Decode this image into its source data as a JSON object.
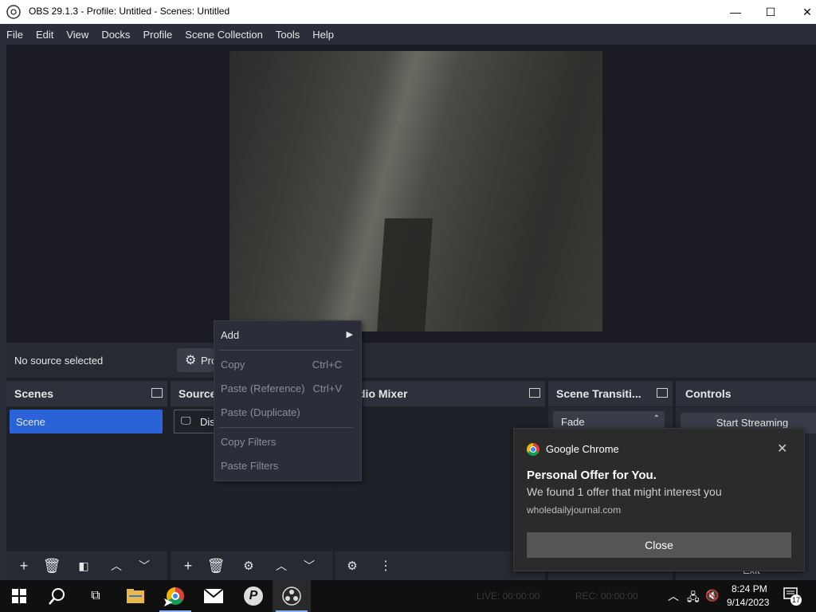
{
  "window": {
    "title": "OBS 29.1.3 - Profile: Untitled - Scenes: Untitled",
    "minimize": "—",
    "maximize": "☐",
    "close": "✕"
  },
  "menu": [
    "File",
    "Edit",
    "View",
    "Docks",
    "Profile",
    "Scene Collection",
    "Tools",
    "Help"
  ],
  "source_bar": {
    "status": "No source selected",
    "properties_label": "Pro"
  },
  "docks": {
    "scenes": {
      "title": "Scenes",
      "items": [
        "Scene"
      ]
    },
    "sources": {
      "title": "Source",
      "item_label": "Dis"
    },
    "audio_mixer": {
      "title": "dio Mixer"
    },
    "transitions": {
      "title": "Scene Transiti...",
      "selected": "Fade"
    },
    "controls": {
      "title": "Controls",
      "start_streaming": "Start Streaming",
      "exit": "Exit"
    }
  },
  "context_menu": {
    "add": "Add",
    "copy": "Copy",
    "copy_shortcut": "Ctrl+C",
    "paste_ref": "Paste (Reference)",
    "paste_ref_shortcut": "Ctrl+V",
    "paste_dup": "Paste (Duplicate)",
    "copy_filters": "Copy Filters",
    "paste_filters": "Paste Filters"
  },
  "notification": {
    "app": "Google Chrome",
    "headline": "Personal Offer for You.",
    "body": "We found 1 offer that might interest you",
    "domain": "wholedailyjournal.com",
    "close_button": "Close"
  },
  "status": {
    "live": "LIVE: 00:00:00",
    "rec": "REC: 00:00:00"
  },
  "taskbar": {
    "time": "8:24 PM",
    "date": "9/14/2023",
    "notif_count": "17"
  }
}
